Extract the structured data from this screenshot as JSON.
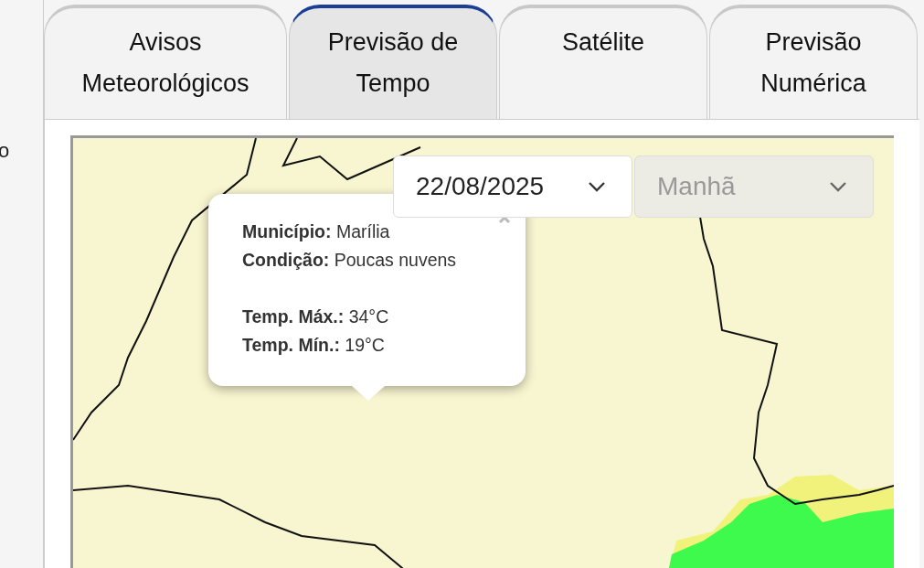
{
  "sidebar_fragment": "o",
  "tabs": [
    {
      "label": "Avisos Meteorológicos",
      "selected": false
    },
    {
      "label": "Previsão de Tempo",
      "selected": true
    },
    {
      "label": "Satélite",
      "selected": false
    },
    {
      "label": "Previsão Numérica",
      "selected": false
    }
  ],
  "date_select": {
    "value": "22/08/2025",
    "disabled": false
  },
  "period_select": {
    "value": "Manhã",
    "disabled": true
  },
  "popup": {
    "groups": [
      [
        "**Município:** Marília",
        "**Condição:** Poucas nuvens"
      ],
      [
        "**Temp. Máx.:** 34°C",
        "**Temp. Mín.:** 19°C"
      ]
    ]
  }
}
